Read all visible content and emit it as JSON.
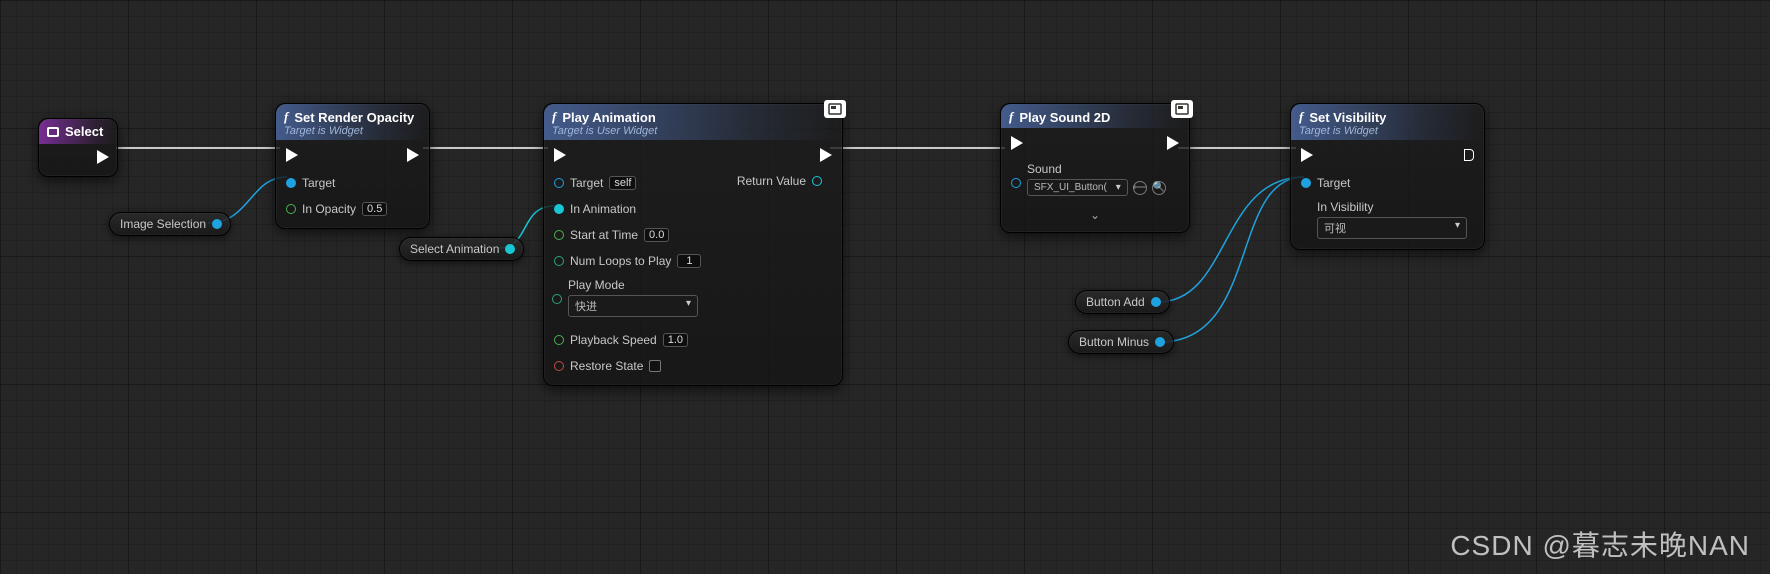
{
  "nodes": {
    "select": {
      "title": "Select"
    },
    "setOpacity": {
      "title": "Set Render Opacity",
      "subtitle": "Target is Widget",
      "pins": {
        "target": "Target",
        "inOpacity": "In Opacity",
        "opacityVal": "0.5"
      }
    },
    "playAnim": {
      "title": "Play Animation",
      "subtitle": "Target is User Widget",
      "pins": {
        "target": "Target",
        "targetVal": "self",
        "inAnimation": "In Animation",
        "startAt": "Start at Time",
        "startAtVal": "0.0",
        "numLoops": "Num Loops to Play",
        "numLoopsVal": "1",
        "playMode": "Play Mode",
        "playModeVal": "快进",
        "playbackSpeed": "Playback Speed",
        "playbackSpeedVal": "1.0",
        "restoreState": "Restore State",
        "returnValue": "Return Value"
      }
    },
    "playSound": {
      "title": "Play Sound 2D",
      "pins": {
        "sound": "Sound",
        "soundAsset": "SFX_UI_Button("
      }
    },
    "setVis": {
      "title": "Set Visibility",
      "subtitle": "Target is Widget",
      "pins": {
        "target": "Target",
        "inVisibility": "In Visibility",
        "inVisibilityVal": "可视"
      }
    }
  },
  "vars": {
    "imageSelection": "Image Selection",
    "selectAnimation": "Select Animation",
    "buttonAdd": "Button Add",
    "buttonMinus": "Button Minus"
  },
  "watermark": "CSDN @暮志未晚NAN"
}
